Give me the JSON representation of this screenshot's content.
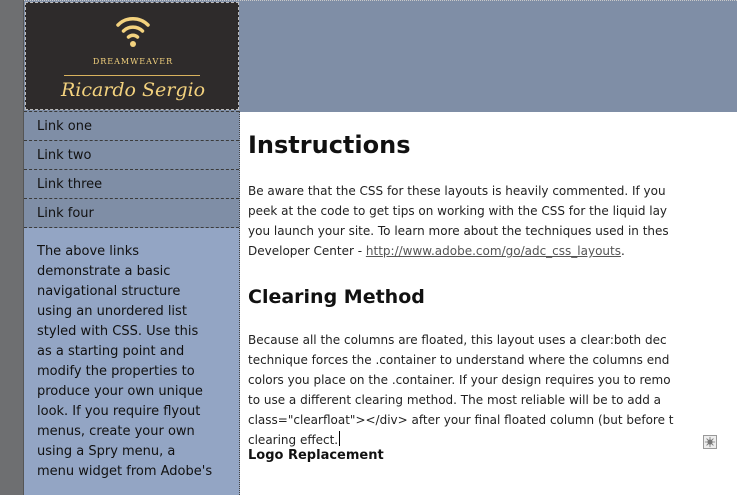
{
  "header": {
    "brand_text": "DREAMWEAVER",
    "signature_text": "Ricardo Sergio"
  },
  "sidebar": {
    "nav": [
      {
        "label": "Link one"
      },
      {
        "label": "Link two"
      },
      {
        "label": "Link three"
      },
      {
        "label": "Link four"
      }
    ],
    "description_lines": [
      "The above links",
      "demonstrate a basic",
      "navigational structure",
      "using an unordered list",
      "styled with CSS. Use this",
      "as a starting point and",
      "modify the properties to",
      "produce your own unique",
      "look. If you require flyout",
      "menus, create your own",
      "using a Spry menu, a",
      "menu widget from Adobe's"
    ]
  },
  "main": {
    "title": "Instructions",
    "intro_lines": [
      "Be aware that the CSS for these layouts is heavily commented. If you",
      "peek at the code to get tips on working with the CSS for the liquid lay",
      "you launch your site. To learn more about the techniques used in thes"
    ],
    "intro_last_prefix": "Developer Center - ",
    "intro_link": "http://www.adobe.com/go/adc_css_layouts",
    "intro_last_suffix": ".",
    "clearing_heading": "Clearing Method",
    "clearing_lines": [
      "Because all the columns are floated, this layout uses a clear:both dec",
      "technique forces the .container to understand where the columns end",
      "colors you place on the .container. If your design requires you to remo",
      "to use a different clearing method. The most reliable will be to add a",
      "class=\"clearfloat\"></div> after your final floated column (but before t",
      "clearing effect."
    ],
    "logo_heading": "Logo Replacement"
  },
  "colors": {
    "header_band": "#7f8ea6",
    "sidebar_bg": "#93a5c4",
    "nav_bg": "#7f8ea6",
    "logo_bg": "#2e2b2b",
    "logo_gold": "#f3d27e"
  }
}
